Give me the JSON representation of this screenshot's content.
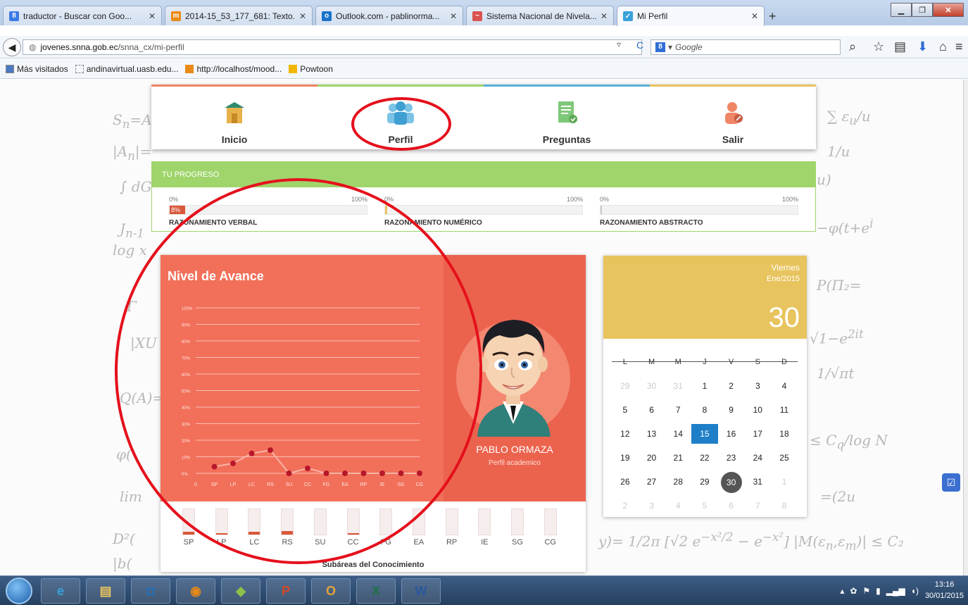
{
  "browser": {
    "tabs": [
      {
        "title": "traductor - Buscar con Goo...",
        "favicon": "8",
        "color": "#3c7ae4"
      },
      {
        "title": "2014-15_53_177_681: Texto...",
        "favicon": "m",
        "color": "#e98a16"
      },
      {
        "title": "Outlook.com - pablinorma...",
        "favicon": "o",
        "color": "#1a73c8"
      },
      {
        "title": "Sistema Nacional de Nivela...",
        "favicon": "~",
        "color": "#d9534f"
      },
      {
        "title": "Mi Perfil",
        "favicon": "✓",
        "color": "#3aa0d9"
      }
    ],
    "new_tab": "+",
    "url_domain": "jovenes.snna.gob.ec",
    "url_path": "/snna_cx/mi-perfil",
    "search_placeholder": "Google",
    "search_engine_icon": "8",
    "bookmarks": [
      "Más visitados",
      "andinavirtual.uasb.edu...",
      "http://localhost/mood...",
      "Powtoon"
    ]
  },
  "nav": {
    "items": [
      {
        "label": "Inicio",
        "icon": "home-icon",
        "color": "#e7b24a"
      },
      {
        "label": "Perfil",
        "icon": "users-icon",
        "color": "#5aaed7"
      },
      {
        "label": "Preguntas",
        "icon": "document-check-icon",
        "color": "#7fc87a"
      },
      {
        "label": "Salir",
        "icon": "user-logout-icon",
        "color": "#f08565"
      }
    ]
  },
  "progress": {
    "title": "TU PROGRESO",
    "min_label": "0%",
    "max_label": "100%",
    "items": [
      {
        "name": "RAZONAMIENTO VERBAL",
        "value": 8,
        "value_label": "8%",
        "color": "#d9583a"
      },
      {
        "name": "RAZONAMIENTO NUMÉRICO",
        "value": 1,
        "value_label": "1",
        "color": "#e8c45e"
      },
      {
        "name": "RAZONAMIENTO ABSTRACTO",
        "value": 0,
        "value_label": "",
        "color": "#cccccc"
      }
    ]
  },
  "avance": {
    "title": "Nivel de Avance",
    "student_name": "PABLO ORMAZA",
    "student_role": "Perfil academico",
    "subareas_title": "Subáreas del Conocimiento",
    "subareas": [
      {
        "label": "SP",
        "value": 10
      },
      {
        "label": "LP",
        "value": 5
      },
      {
        "label": "LC",
        "value": 10
      },
      {
        "label": "RS",
        "value": 15
      },
      {
        "label": "SU",
        "value": 0
      },
      {
        "label": "CC",
        "value": 5
      },
      {
        "label": "FG",
        "value": 0
      },
      {
        "label": "EA",
        "value": 0
      },
      {
        "label": "RP",
        "value": 0
      },
      {
        "label": "IE",
        "value": 0
      },
      {
        "label": "SG",
        "value": 0
      },
      {
        "label": "CG",
        "value": 0
      }
    ]
  },
  "chart_data": {
    "type": "line",
    "categories": [
      "0",
      "SP",
      "LP",
      "LC",
      "RS",
      "SU",
      "CC",
      "FG",
      "EA",
      "RP",
      "IE",
      "SG",
      "CG"
    ],
    "values": [
      null,
      4,
      6,
      12,
      14,
      0,
      3,
      0,
      0,
      0,
      0,
      0,
      0
    ],
    "yticks": [
      "0%",
      "10%",
      "20%",
      "30%",
      "40%",
      "50%",
      "60%",
      "70%",
      "80%",
      "90%",
      "100%"
    ],
    "ylim": [
      0,
      100
    ],
    "grid": true,
    "line_color": "#f7b3a6",
    "point_color": "#b8172a"
  },
  "calendar": {
    "day_name": "Viernes",
    "month_year": "Ene/2015",
    "day_number": "30",
    "weekdays": [
      "L",
      "M",
      "M",
      "J",
      "V",
      "S",
      "D"
    ],
    "weeks": [
      [
        "29",
        "30",
        "31",
        "1",
        "2",
        "3",
        "4"
      ],
      [
        "5",
        "6",
        "7",
        "8",
        "9",
        "10",
        "11"
      ],
      [
        "12",
        "13",
        "14",
        "15",
        "16",
        "17",
        "18"
      ],
      [
        "19",
        "20",
        "21",
        "22",
        "23",
        "24",
        "25"
      ],
      [
        "26",
        "27",
        "28",
        "29",
        "30",
        "31",
        "1"
      ],
      [
        "2",
        "3",
        "4",
        "5",
        "6",
        "7",
        "8"
      ]
    ],
    "today": "15",
    "selected": "30"
  },
  "taskbar": {
    "apps": [
      {
        "name": "internet-explorer",
        "glyph": "e"
      },
      {
        "name": "file-explorer",
        "glyph": "▤"
      },
      {
        "name": "media-player",
        "glyph": "◘"
      },
      {
        "name": "firefox",
        "glyph": "◉"
      },
      {
        "name": "shapes-app",
        "glyph": "◆"
      },
      {
        "name": "powerpoint",
        "glyph": "P"
      },
      {
        "name": "outlook",
        "glyph": "O"
      },
      {
        "name": "excel",
        "glyph": "X"
      },
      {
        "name": "word",
        "glyph": "W"
      }
    ],
    "time": "13:16",
    "date": "30/01/2015"
  }
}
